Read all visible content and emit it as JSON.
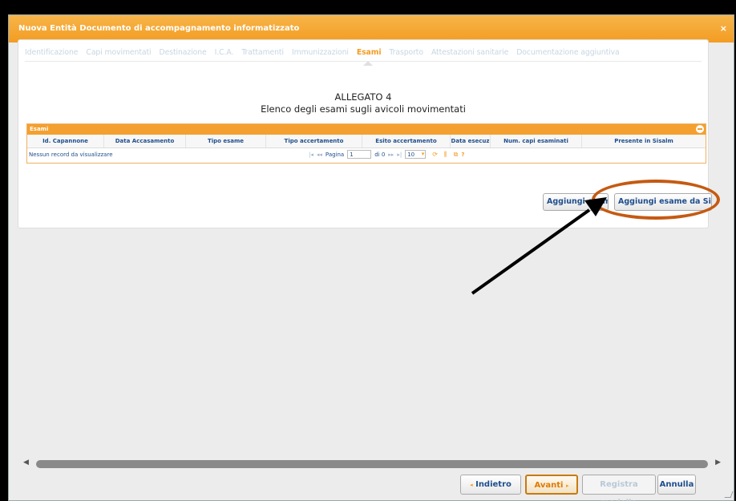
{
  "dialog": {
    "title": "Nuova Entità Documento di accompagnamento informatizzato",
    "close": "×"
  },
  "tabs": [
    {
      "label": "Identificazione",
      "active": false
    },
    {
      "label": "Capi movimentati",
      "active": false
    },
    {
      "label": "Destinazione",
      "active": false
    },
    {
      "label": "I.C.A.",
      "active": false
    },
    {
      "label": "Trattamenti",
      "active": false
    },
    {
      "label": "Immunizzazioni",
      "active": false
    },
    {
      "label": "Esami",
      "active": true
    },
    {
      "label": "Trasporto",
      "active": false
    },
    {
      "label": "Attestazioni sanitarie",
      "active": false
    },
    {
      "label": "Documentazione aggiuntiva",
      "active": false
    }
  ],
  "section": {
    "heading": "ALLEGATO 4",
    "subheading": "Elenco degli esami sugli avicoli movimentati"
  },
  "grid": {
    "title": "Esami",
    "columns": [
      "Id. Capannone",
      "Data Accasamento",
      "Tipo esame",
      "Tipo accertamento",
      "Esito accertamento",
      "Data esecuz",
      "Num. capi esaminati",
      "Presente in Sisalm"
    ],
    "empty_message": "Nessun record da visualizzare",
    "pager": {
      "first": "|◂",
      "prev": "◂◂",
      "page_label": "Pagina",
      "page_value": "1",
      "of_label": "di 0",
      "next": "▸▸",
      "last": "▸|",
      "page_size": "10",
      "refresh": "⟳",
      "help": "?"
    }
  },
  "buttons": {
    "add_exam": "Aggiungi esame",
    "add_exam_sisalm": "Aggiungi esame da Sisalm"
  },
  "footer": {
    "back": "Indietro",
    "next": "Avanti",
    "save_model": "Registra modello",
    "cancel": "Annulla"
  },
  "colors": {
    "accent": "#F39C22",
    "annotation": "#C55A11"
  }
}
